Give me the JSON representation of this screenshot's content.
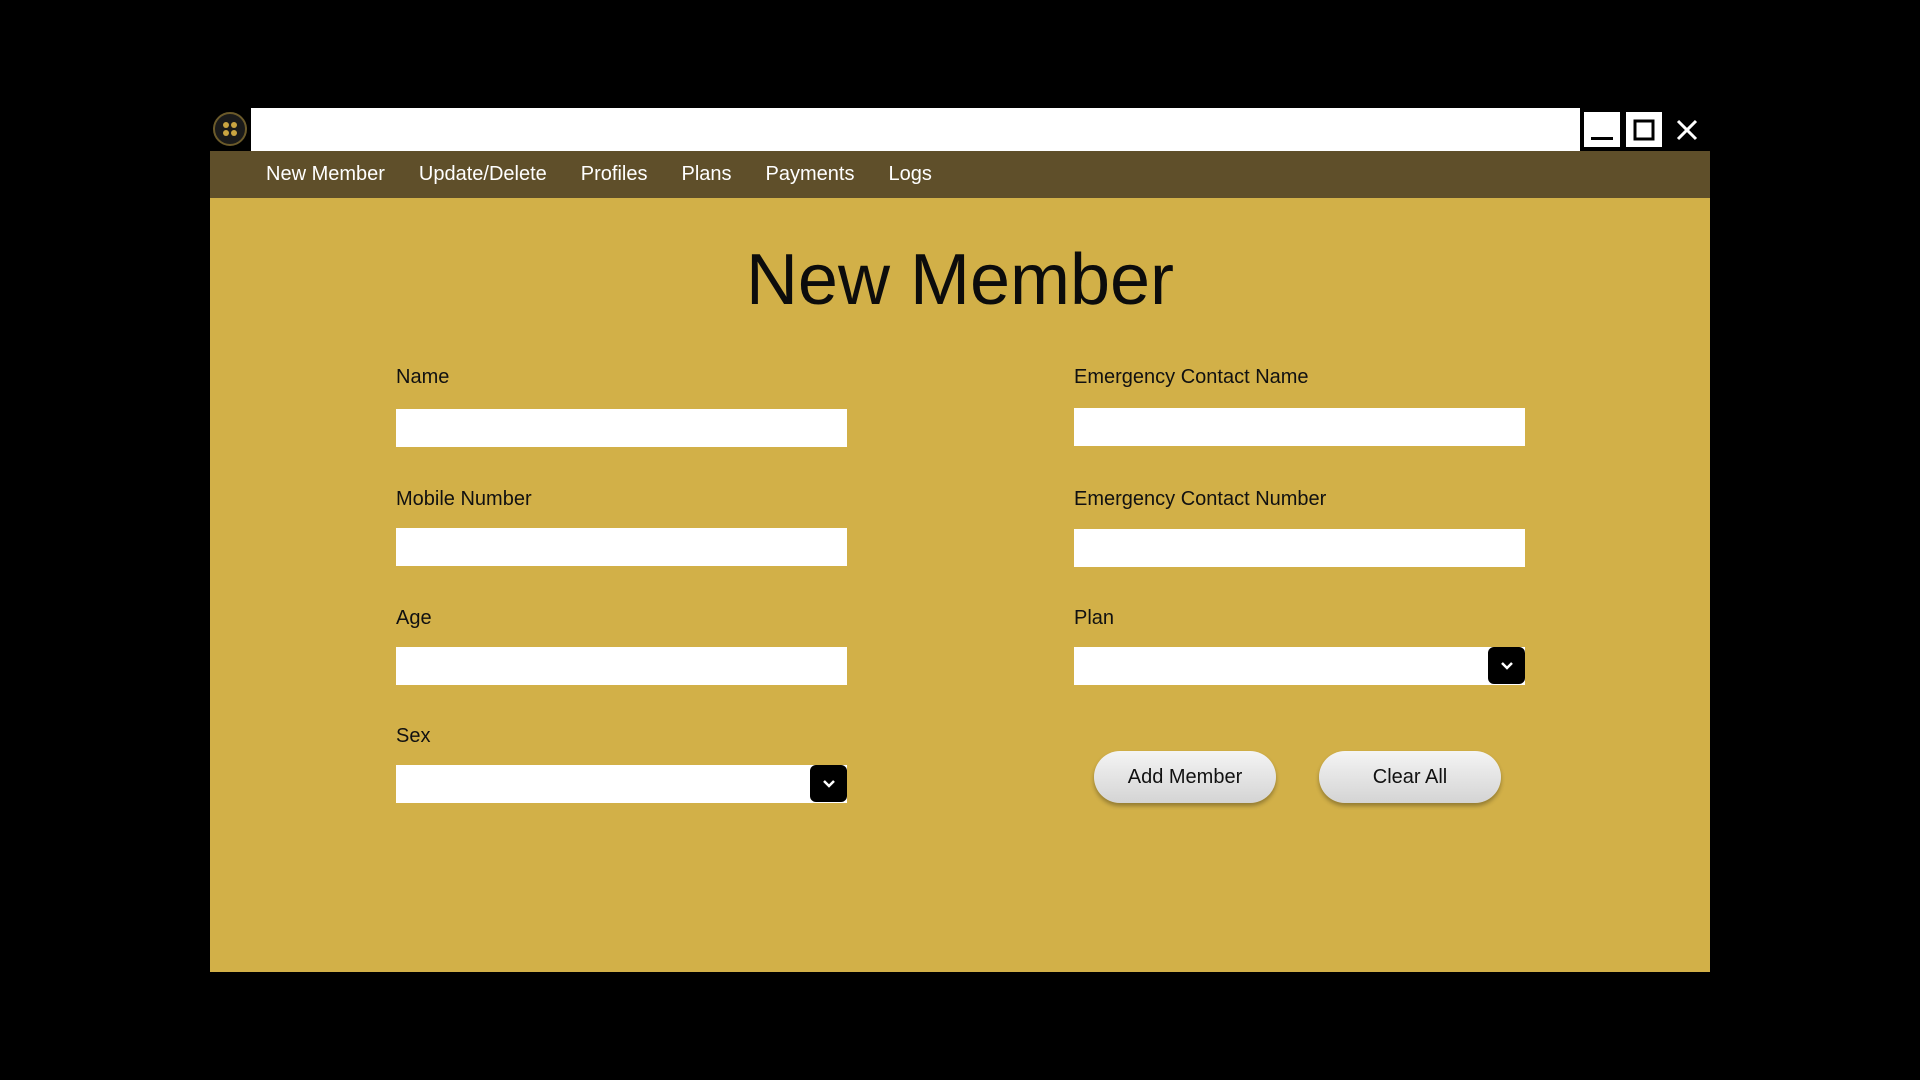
{
  "window": {
    "title": "",
    "logo_icon": "gym-logo-icon",
    "controls": {
      "minimize_icon": "minimize-icon",
      "maximize_icon": "maximize-icon",
      "close_icon": "close-icon"
    }
  },
  "menu": {
    "items": [
      "New Member",
      "Update/Delete",
      "Profiles",
      "Plans",
      "Payments",
      "Logs"
    ]
  },
  "page": {
    "title": "New Member"
  },
  "form": {
    "name": {
      "label": "Name",
      "value": ""
    },
    "mobile": {
      "label": "Mobile Number",
      "value": ""
    },
    "age": {
      "label": "Age",
      "value": ""
    },
    "sex": {
      "label": "Sex",
      "value": ""
    },
    "emergency_name": {
      "label": "Emergency Contact Name",
      "value": ""
    },
    "emergency_number": {
      "label": "Emergency Contact Number",
      "value": ""
    },
    "plan": {
      "label": "Plan",
      "value": ""
    }
  },
  "buttons": {
    "add": "Add Member",
    "clear": "Clear All"
  },
  "colors": {
    "background": "#d2b048",
    "menubar": "#5f4f2a",
    "outer": "#000000"
  }
}
